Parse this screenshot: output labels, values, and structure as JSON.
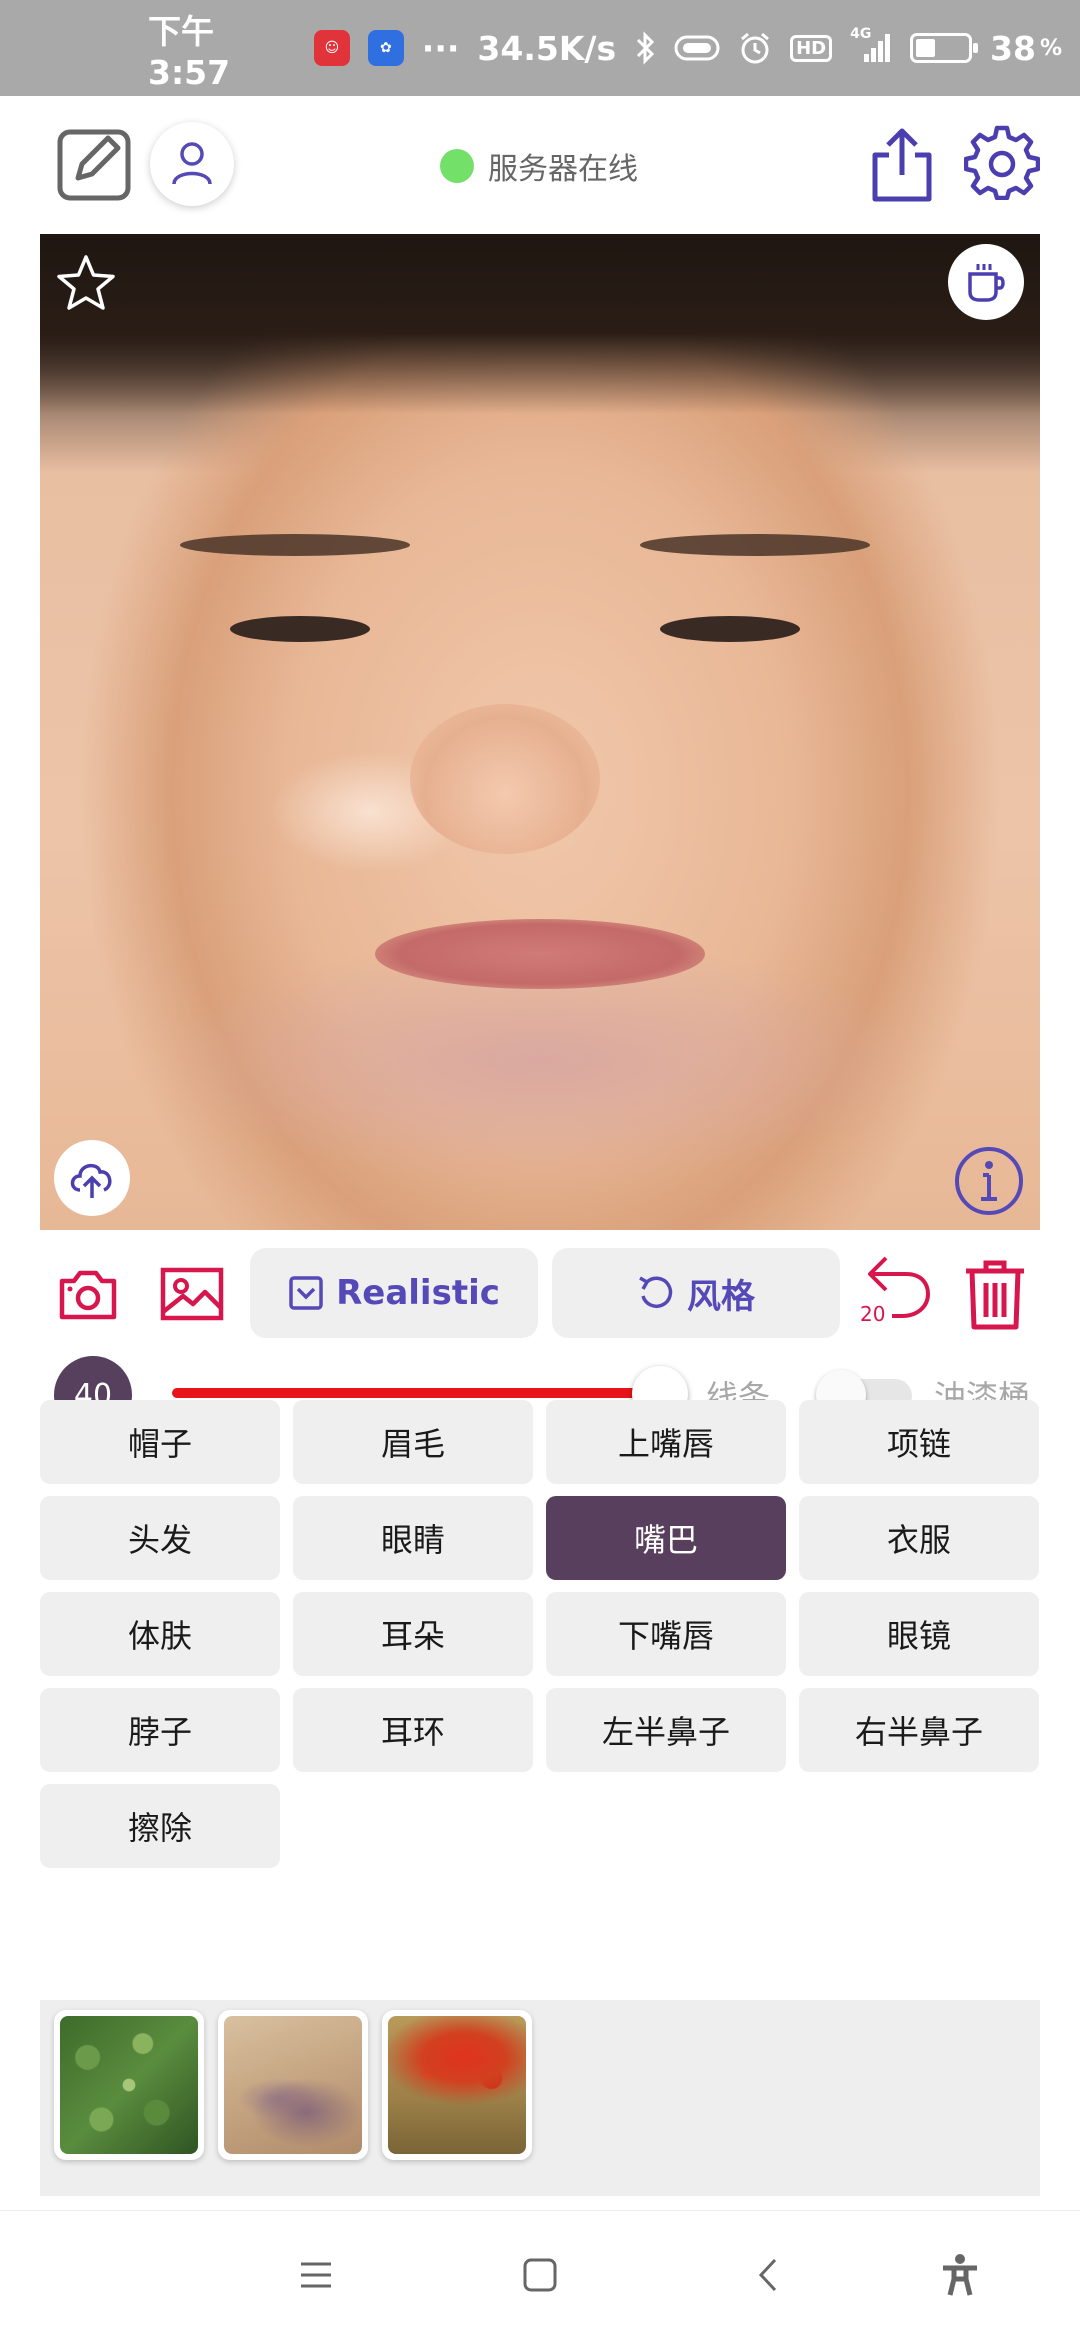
{
  "status_bar": {
    "time": "下午3:57",
    "network_speed": "34.5K/s",
    "more": "···",
    "hd_label": "HD",
    "signal_label": "4G",
    "battery_percent": "38",
    "battery_unit": "%",
    "battery_level": 0.38,
    "app_icons": [
      "red-app-icon",
      "baidu-paw-icon"
    ]
  },
  "header": {
    "server_status": "服务器在线",
    "server_status_color": "#73e06a",
    "icons": [
      "edit-icon",
      "user-icon",
      "share-icon",
      "gear-icon"
    ]
  },
  "photo": {
    "overlay_icons": [
      "star-icon",
      "coffee-cup-icon",
      "cloud-upload-icon",
      "info-icon"
    ]
  },
  "toolbar": {
    "mode_label": "Realistic",
    "style_label": "风格",
    "undo_count": "20",
    "accent_color": "#d8164e",
    "button_text_color": "#5549b8"
  },
  "brush": {
    "size": "40",
    "level": 0.95,
    "track_color": "#e8141a",
    "line_label": "线条",
    "bucket_label": "油漆桶",
    "bucket_on": false
  },
  "segments": {
    "rows": [
      [
        "帽子",
        "眉毛",
        "上嘴唇",
        "项链"
      ],
      [
        "头发",
        "眼睛",
        "嘴巴",
        "衣服"
      ],
      [
        "体肤",
        "耳朵",
        "下嘴唇",
        "眼镜"
      ],
      [
        "脖子",
        "耳环",
        "左半鼻子",
        "右半鼻子"
      ],
      [
        "擦除"
      ]
    ],
    "active": "嘴巴",
    "active_color": "#583f5d"
  },
  "style_thumbnails": [
    "green-foliage-texture",
    "brown-paper-texture",
    "red-flower-painting"
  ],
  "nav": {
    "icons": [
      "menu-icon",
      "home-icon",
      "back-icon",
      "accessibility-icon"
    ]
  }
}
